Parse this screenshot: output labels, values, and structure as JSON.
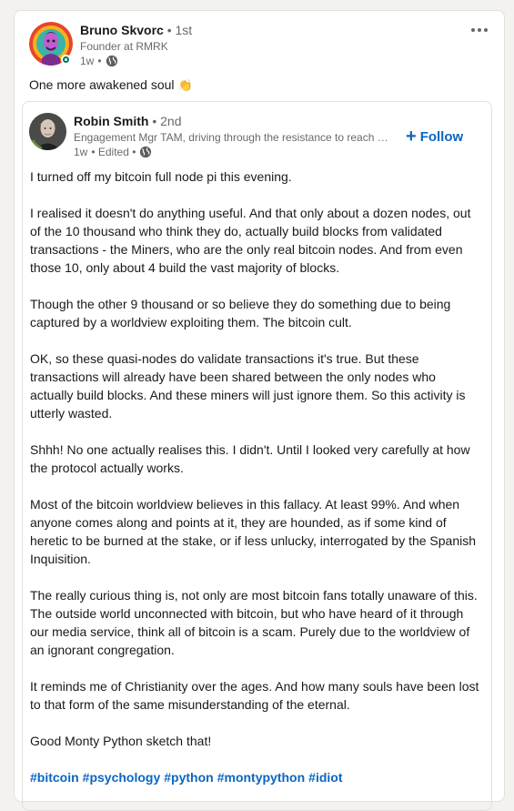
{
  "outer_post": {
    "author_name": "Bruno Skvorc",
    "degree": "• 1st",
    "headline": "Founder at RMRK",
    "time": "1w",
    "separator": "•",
    "visibility_icon": "globe-icon",
    "commentary": "One more awakened soul",
    "emoji": "👏",
    "more_icon": "ellipsis-icon"
  },
  "reshared_post": {
    "author_name": "Robin Smith",
    "degree": "• 2nd",
    "headline": "Engagement Mgr TAM, driving through the resistance to reach …",
    "time": "1w",
    "edited": "• Edited •",
    "visibility_icon": "globe-icon",
    "follow_icon": "plus-icon",
    "follow_label": "Follow",
    "paragraphs": [
      "I turned off my bitcoin full node pi this evening.",
      "I realised it doesn't do anything useful. And that only about a dozen nodes, out of the 10 thousand who think they do, actually build blocks from validated transactions - the Miners, who are the only real bitcoin nodes. And from even those 10, only about 4 build the vast majority of blocks.",
      "Though the other 9 thousand or so believe they do something due to being captured by a worldview exploiting them. The bitcoin cult.",
      "OK, so these quasi-nodes do validate transactions it's true. But these transactions will already have been shared between the only nodes who actually build blocks. And these miners will just ignore them. So this activity is utterly wasted.",
      "Shhh! No one actually realises this. I didn't. Until I looked very carefully at how the protocol actually works.",
      "Most of the bitcoin worldview believes in this fallacy. At least 99%. And when anyone comes along and points at it, they are hounded, as if some kind of heretic to be burned at the stake, or if less unlucky, interrogated by the Spanish Inquisition.",
      "The really curious thing is, not only are most bitcoin fans totally unaware of this. The outside world unconnected with bitcoin, but who have heard of it through our media service, think all of bitcoin is a scam. Purely due to the worldview of an ignorant congregation.",
      "It reminds me of Christianity over the ages. And how many souls have been lost to that form of the same misunderstanding of the eternal.",
      "Good Monty Python sketch that!"
    ],
    "hashtags": [
      "#bitcoin",
      "#psychology",
      "#python",
      "#montypython",
      "#idiot"
    ]
  },
  "colors": {
    "link_blue": "#0a66c2",
    "presence_green": "#01754f",
    "page_bg": "#f4f2ee"
  }
}
